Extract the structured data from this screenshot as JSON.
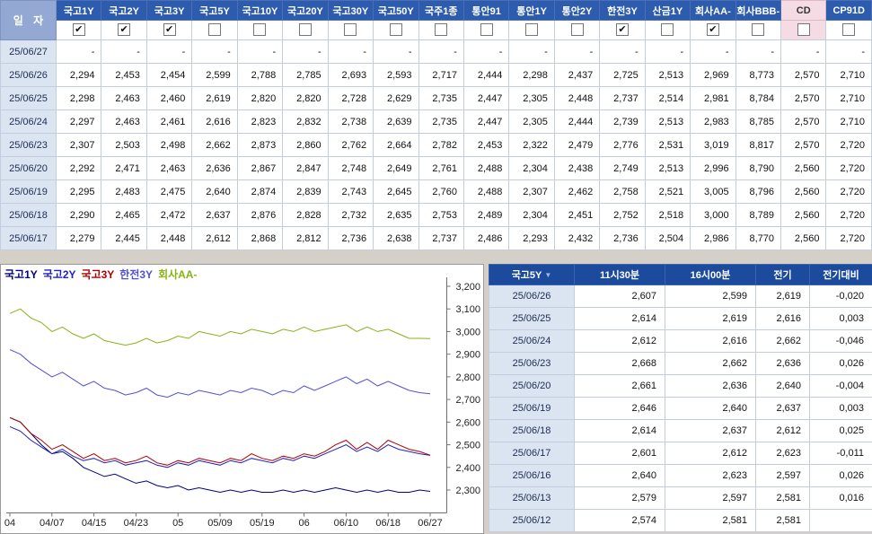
{
  "icons": {
    "check": "✔",
    "sort_desc": "▼"
  },
  "colors": {
    "column_header_bg": "#2d5cae",
    "selected_column_bg": "#f5dce4",
    "date_column_bg": "#dbe5f2",
    "detail_header_bg": "#1c4a9c",
    "positive_change": "#d00014",
    "negative_change": "#0000cc"
  },
  "top_table": {
    "date_header": "일 자",
    "columns": [
      {
        "label": "국고1Y",
        "checked": true
      },
      {
        "label": "국고2Y",
        "checked": true
      },
      {
        "label": "국고3Y",
        "checked": true
      },
      {
        "label": "국고5Y",
        "checked": false
      },
      {
        "label": "국고10Y",
        "checked": false
      },
      {
        "label": "국고20Y",
        "checked": false
      },
      {
        "label": "국고30Y",
        "checked": false
      },
      {
        "label": "국고50Y",
        "checked": false
      },
      {
        "label": "국주1종",
        "checked": false
      },
      {
        "label": "통안91",
        "checked": false
      },
      {
        "label": "통안1Y",
        "checked": false
      },
      {
        "label": "통안2Y",
        "checked": false
      },
      {
        "label": "한전3Y",
        "checked": true
      },
      {
        "label": "산금1Y",
        "checked": false
      },
      {
        "label": "회사AA-",
        "checked": true
      },
      {
        "label": "회사BBB-",
        "checked": false
      },
      {
        "label": "CD",
        "checked": false,
        "highlight": true
      },
      {
        "label": "CP91D",
        "checked": false
      }
    ],
    "rows": [
      {
        "date": "25/06/27",
        "values": [
          "-",
          "-",
          "-",
          "-",
          "-",
          "-",
          "-",
          "-",
          "-",
          "-",
          "-",
          "-",
          "-",
          "-",
          "-",
          "-",
          "-",
          "-"
        ]
      },
      {
        "date": "25/06/26",
        "values": [
          "2,294",
          "2,453",
          "2,454",
          "2,599",
          "2,788",
          "2,785",
          "2,693",
          "2,593",
          "2,717",
          "2,444",
          "2,298",
          "2,437",
          "2,725",
          "2,513",
          "2,969",
          "8,773",
          "2,570",
          "2,710"
        ]
      },
      {
        "date": "25/06/25",
        "values": [
          "2,298",
          "2,463",
          "2,460",
          "2,619",
          "2,820",
          "2,820",
          "2,728",
          "2,629",
          "2,735",
          "2,447",
          "2,305",
          "2,448",
          "2,737",
          "2,514",
          "2,981",
          "8,784",
          "2,570",
          "2,710"
        ]
      },
      {
        "date": "25/06/24",
        "values": [
          "2,297",
          "2,463",
          "2,461",
          "2,616",
          "2,823",
          "2,832",
          "2,738",
          "2,639",
          "2,735",
          "2,447",
          "2,305",
          "2,444",
          "2,739",
          "2,513",
          "2,983",
          "8,785",
          "2,570",
          "2,710"
        ]
      },
      {
        "date": "25/06/23",
        "values": [
          "2,307",
          "2,503",
          "2,498",
          "2,662",
          "2,873",
          "2,860",
          "2,762",
          "2,664",
          "2,782",
          "2,453",
          "2,322",
          "2,479",
          "2,776",
          "2,531",
          "3,019",
          "8,817",
          "2,570",
          "2,720"
        ]
      },
      {
        "date": "25/06/20",
        "values": [
          "2,292",
          "2,471",
          "2,463",
          "2,636",
          "2,867",
          "2,847",
          "2,748",
          "2,649",
          "2,761",
          "2,488",
          "2,304",
          "2,438",
          "2,749",
          "2,513",
          "2,996",
          "8,790",
          "2,560",
          "2,720"
        ]
      },
      {
        "date": "25/06/19",
        "values": [
          "2,295",
          "2,483",
          "2,475",
          "2,640",
          "2,874",
          "2,839",
          "2,743",
          "2,645",
          "2,760",
          "2,488",
          "2,307",
          "2,462",
          "2,758",
          "2,521",
          "3,005",
          "8,796",
          "2,560",
          "2,720"
        ]
      },
      {
        "date": "25/06/18",
        "values": [
          "2,290",
          "2,465",
          "2,472",
          "2,637",
          "2,876",
          "2,828",
          "2,732",
          "2,635",
          "2,753",
          "2,489",
          "2,304",
          "2,451",
          "2,752",
          "2,518",
          "3,000",
          "8,789",
          "2,560",
          "2,720"
        ]
      },
      {
        "date": "25/06/17",
        "values": [
          "2,279",
          "2,445",
          "2,448",
          "2,612",
          "2,868",
          "2,812",
          "2,736",
          "2,638",
          "2,737",
          "2,486",
          "2,293",
          "2,432",
          "2,736",
          "2,504",
          "2,986",
          "8,770",
          "2,560",
          "2,720"
        ]
      }
    ]
  },
  "chart_data": {
    "type": "line",
    "title": "",
    "legend_position": "top-left",
    "y_axis_side": "right",
    "ylim": [
      2.2,
      3.25
    ],
    "yticks": [
      2.3,
      2.4,
      2.5,
      2.6,
      2.7,
      2.8,
      2.9,
      3.0,
      3.1,
      3.2
    ],
    "ytick_labels": [
      "2,300",
      "2,400",
      "2,500",
      "2,600",
      "2,700",
      "2,800",
      "2,900",
      "3,000",
      "3,100",
      "3,200"
    ],
    "xtick_labels": [
      "04",
      "04/07",
      "04/15",
      "04/23",
      "05",
      "05/09",
      "05/19",
      "06",
      "06/10",
      "06/18",
      "06/27"
    ],
    "series": [
      {
        "name": "국고1Y",
        "color": "#000080",
        "values": [
          2.62,
          2.6,
          2.55,
          2.5,
          2.46,
          2.47,
          2.44,
          2.4,
          2.38,
          2.36,
          2.37,
          2.35,
          2.33,
          2.34,
          2.32,
          2.31,
          2.32,
          2.3,
          2.31,
          2.3,
          2.29,
          2.3,
          2.29,
          2.3,
          2.29,
          2.29,
          2.3,
          2.29,
          2.3,
          2.29,
          2.3,
          2.31,
          2.3,
          2.29,
          2.3,
          2.29,
          2.3,
          2.29,
          2.29,
          2.3,
          2.294
        ]
      },
      {
        "name": "국고2Y",
        "color": "#2020c0",
        "values": [
          2.58,
          2.56,
          2.52,
          2.49,
          2.46,
          2.48,
          2.45,
          2.43,
          2.44,
          2.42,
          2.43,
          2.41,
          2.42,
          2.43,
          2.41,
          2.4,
          2.42,
          2.41,
          2.43,
          2.42,
          2.41,
          2.43,
          2.42,
          2.44,
          2.43,
          2.42,
          2.44,
          2.43,
          2.45,
          2.44,
          2.46,
          2.48,
          2.5,
          2.47,
          2.49,
          2.47,
          2.5,
          2.48,
          2.47,
          2.46,
          2.453
        ]
      },
      {
        "name": "국고3Y",
        "color": "#b00000",
        "values": [
          2.62,
          2.6,
          2.55,
          2.52,
          2.48,
          2.5,
          2.47,
          2.44,
          2.46,
          2.43,
          2.44,
          2.42,
          2.43,
          2.45,
          2.42,
          2.41,
          2.43,
          2.42,
          2.44,
          2.43,
          2.42,
          2.44,
          2.43,
          2.46,
          2.44,
          2.43,
          2.45,
          2.44,
          2.46,
          2.45,
          2.47,
          2.5,
          2.52,
          2.48,
          2.51,
          2.48,
          2.52,
          2.5,
          2.48,
          2.47,
          2.454
        ]
      },
      {
        "name": "한전3Y",
        "color": "#5050d8",
        "values": [
          2.92,
          2.9,
          2.86,
          2.83,
          2.8,
          2.82,
          2.79,
          2.76,
          2.78,
          2.75,
          2.74,
          2.72,
          2.73,
          2.75,
          2.72,
          2.71,
          2.73,
          2.72,
          2.74,
          2.73,
          2.72,
          2.74,
          2.73,
          2.75,
          2.74,
          2.72,
          2.74,
          2.73,
          2.76,
          2.74,
          2.76,
          2.78,
          2.8,
          2.77,
          2.79,
          2.76,
          2.78,
          2.76,
          2.74,
          2.73,
          2.725
        ]
      },
      {
        "name": "회사AA-",
        "color": "#84b414",
        "values": [
          3.08,
          3.1,
          3.06,
          3.04,
          3.0,
          3.02,
          2.99,
          2.97,
          2.99,
          2.96,
          2.95,
          2.94,
          2.95,
          2.97,
          2.95,
          2.96,
          2.98,
          2.97,
          3.0,
          2.99,
          2.98,
          3.0,
          2.99,
          3.01,
          3.0,
          2.99,
          3.01,
          3.0,
          3.02,
          3.0,
          3.01,
          3.02,
          3.03,
          3.0,
          3.02,
          3.0,
          3.01,
          2.99,
          2.97,
          2.97,
          2.969
        ]
      }
    ]
  },
  "right_table": {
    "headers": [
      "국고5Y",
      "11시30분",
      "16시00분",
      "전기",
      "전기대비"
    ],
    "rows": [
      {
        "date": "25/06/26",
        "t1130": "2,607",
        "t1600": "2,599",
        "prev": "2,619",
        "diff": "-0,020",
        "diff_color": "blue"
      },
      {
        "date": "25/06/25",
        "t1130": "2,614",
        "t1600": "2,619",
        "prev": "2,616",
        "diff": "0,003",
        "diff_color": "red"
      },
      {
        "date": "25/06/24",
        "t1130": "2,612",
        "t1600": "2,616",
        "prev": "2,662",
        "diff": "-0,046",
        "diff_color": "blue"
      },
      {
        "date": "25/06/23",
        "t1130": "2,668",
        "t1600": "2,662",
        "prev": "2,636",
        "diff": "0,026",
        "diff_color": "red"
      },
      {
        "date": "25/06/20",
        "t1130": "2,661",
        "t1600": "2,636",
        "prev": "2,640",
        "diff": "-0,004",
        "diff_color": "blue"
      },
      {
        "date": "25/06/19",
        "t1130": "2,646",
        "t1600": "2,640",
        "prev": "2,637",
        "diff": "0,003",
        "diff_color": "red"
      },
      {
        "date": "25/06/18",
        "t1130": "2,614",
        "t1600": "2,637",
        "prev": "2,612",
        "diff": "0,025",
        "diff_color": "red"
      },
      {
        "date": "25/06/17",
        "t1130": "2,601",
        "t1600": "2,612",
        "prev": "2,623",
        "diff": "-0,011",
        "diff_color": "blue"
      },
      {
        "date": "25/06/16",
        "t1130": "2,640",
        "t1600": "2,623",
        "prev": "2,597",
        "diff": "0,026",
        "diff_color": "red"
      },
      {
        "date": "25/06/13",
        "t1130": "2,579",
        "t1600": "2,597",
        "prev": "2,581",
        "diff": "0,016",
        "diff_color": "red"
      },
      {
        "date": "25/06/12",
        "t1130": "2,574",
        "t1600": "2,581",
        "prev": "2,581",
        "diff": "",
        "diff_color": "none"
      }
    ]
  }
}
